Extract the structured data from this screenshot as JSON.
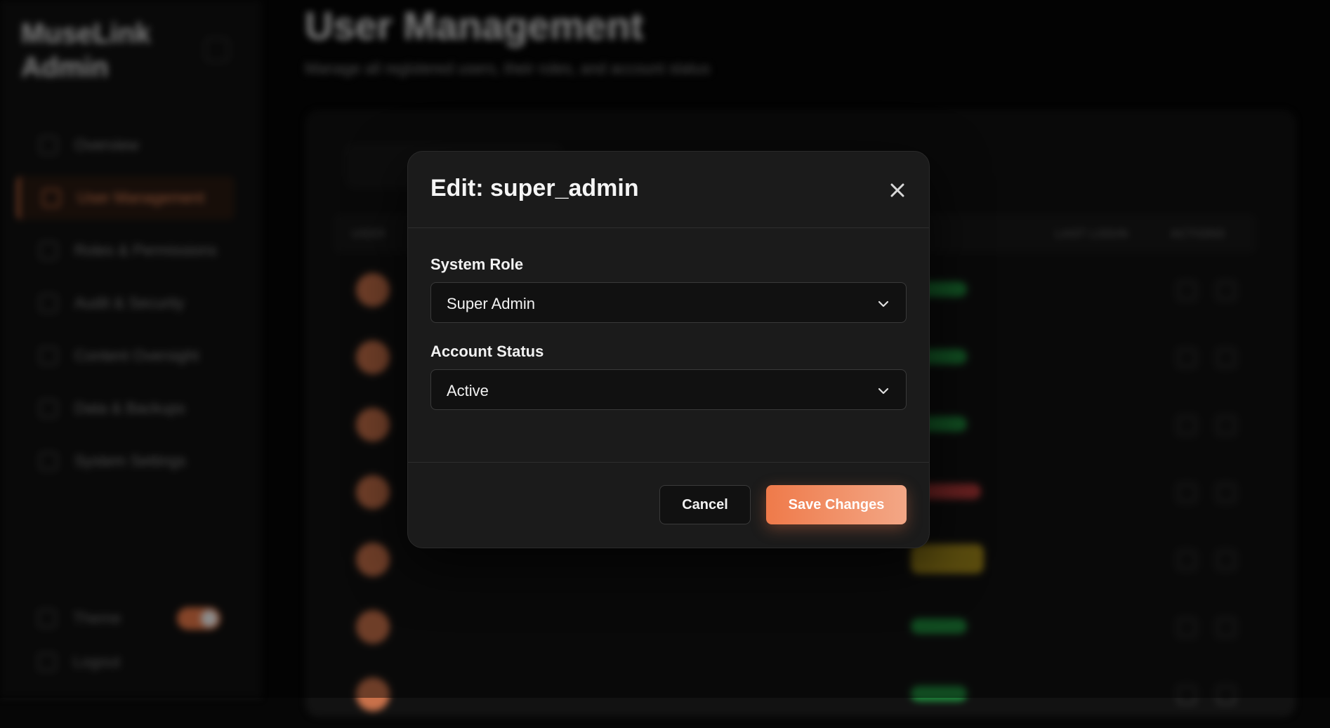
{
  "app": {
    "brand": "MuseLink Admin",
    "sidebar": {
      "items": [
        {
          "label": "Overview"
        },
        {
          "label": "User Management"
        },
        {
          "label": "Roles & Permissions"
        },
        {
          "label": "Audit & Security"
        },
        {
          "label": "Content Oversight"
        },
        {
          "label": "Data & Backups"
        },
        {
          "label": "System Settings"
        }
      ],
      "theme_label": "Theme",
      "logout_label": "Logout"
    },
    "header": {
      "title": "User Management",
      "subtitle": "Manage all registered users, their roles, and account status"
    },
    "table": {
      "columns": [
        "USER",
        "LAST LOGIN",
        "ACTIONS"
      ]
    }
  },
  "modal": {
    "title": "Edit: super_admin",
    "fields": [
      {
        "label": "System Role",
        "value": "Super Admin"
      },
      {
        "label": "Account Status",
        "value": "Active"
      }
    ],
    "cancel_label": "Cancel",
    "save_label": "Save Changes"
  },
  "colors": {
    "accent": "#f07c4a",
    "modal_bg": "#1b1b1b",
    "input_bg": "#111111"
  }
}
